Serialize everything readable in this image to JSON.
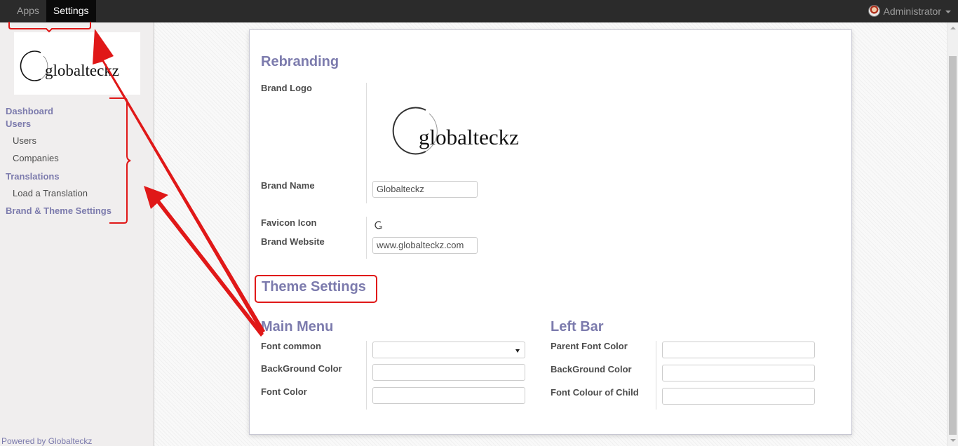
{
  "topbar": {
    "menu": [
      {
        "label": "Apps",
        "active": false
      },
      {
        "label": "Settings",
        "active": true
      }
    ],
    "user": "Administrator"
  },
  "sidebar": {
    "logo_text": "globalteckz",
    "sections": [
      {
        "title": "Dashboard",
        "items": []
      },
      {
        "title": "Users",
        "items": [
          "Users",
          "Companies"
        ]
      },
      {
        "title": "Translations",
        "items": [
          "Load a Translation"
        ]
      },
      {
        "title": "Brand & Theme Settings",
        "items": []
      }
    ],
    "footer": "Powered by Globalteckz"
  },
  "form": {
    "rebranding_title": "Rebranding",
    "brand_logo_label": "Brand Logo",
    "brand_logo_text": "globalteckz",
    "brand_name_label": "Brand Name",
    "brand_name_value": "Globalteckz",
    "favicon_label": "Favicon Icon",
    "brand_website_label": "Brand Website",
    "brand_website_value": "www.globalteckz.com",
    "theme_settings_title": "Theme Settings",
    "main_menu": {
      "title": "Main Menu",
      "font_common_label": "Font common",
      "font_common_value": "",
      "background_color_label": "BackGround Color",
      "background_color_value": "",
      "font_color_label": "Font Color",
      "font_color_value": ""
    },
    "left_bar": {
      "title": "Left Bar",
      "parent_font_color_label": "Parent Font Color",
      "parent_font_color_value": "",
      "background_color_label": "BackGround Color",
      "background_color_value": "",
      "child_font_colour_label": "Font Colour of Child",
      "child_font_colour_value": ""
    }
  },
  "colors": {
    "accent": "#7c7bad",
    "topbar": "#2b2b2b",
    "annotation": "#e01818"
  }
}
